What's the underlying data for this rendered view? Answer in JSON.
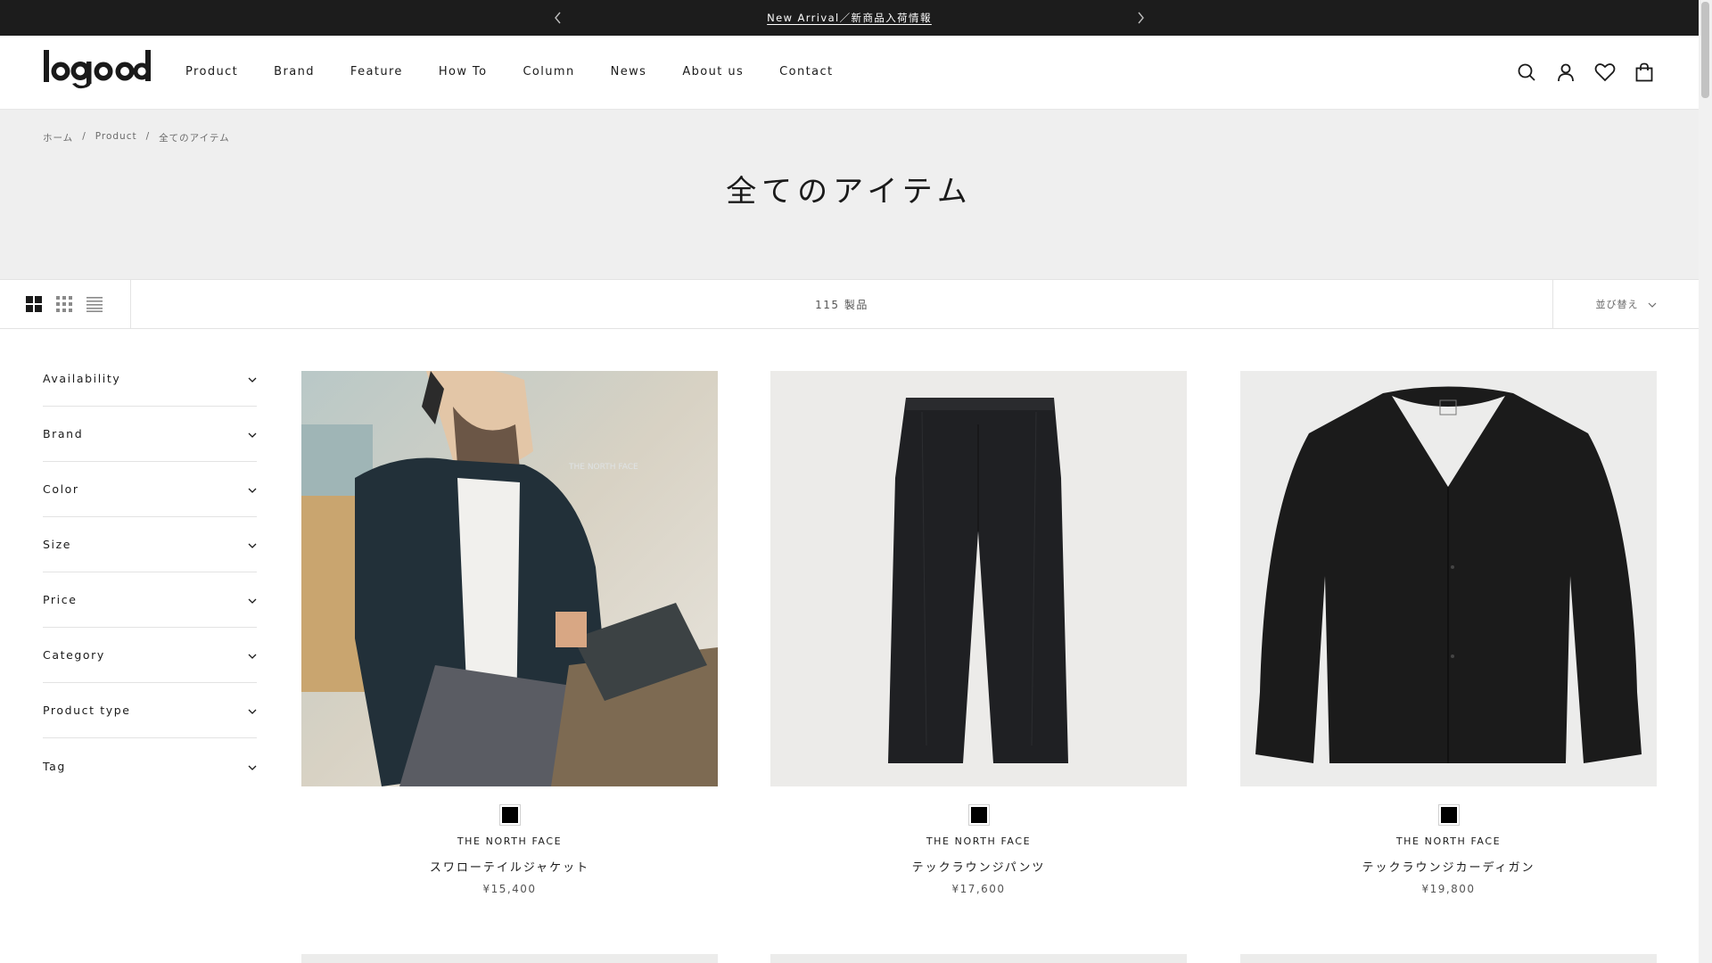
{
  "announcement": {
    "text": "New Arrival／新商品入荷情報"
  },
  "header": {
    "logo_text": "logood",
    "nav": [
      "Product",
      "Brand",
      "Feature",
      "How To",
      "Column",
      "News",
      "About us",
      "Contact"
    ],
    "icons": [
      "search-icon",
      "account-icon",
      "wishlist-icon",
      "cart-icon"
    ]
  },
  "breadcrumb": [
    "ホーム",
    "Product",
    "全てのアイテム"
  ],
  "page_title": "全てのアイテム",
  "toolbar": {
    "view_options": [
      "grid-large-icon",
      "grid-small-icon",
      "list-icon"
    ],
    "count": "115 製品",
    "sort_label": "並び替え"
  },
  "filters": [
    "Availability",
    "Brand",
    "Color",
    "Size",
    "Price",
    "Category",
    "Product type",
    "Tag"
  ],
  "products": [
    {
      "brand": "THE NORTH FACE",
      "name": "スワローテイルジャケット",
      "price": "¥15,400",
      "swatch_color": "#000000"
    },
    {
      "brand": "THE NORTH FACE",
      "name": "テックラウンジパンツ",
      "price": "¥17,600",
      "swatch_color": "#000000"
    },
    {
      "brand": "THE NORTH FACE",
      "name": "テックラウンジカーディガン",
      "price": "¥19,800",
      "swatch_color": "#000000"
    }
  ],
  "colors": {
    "announce_bg": "#1c1c1c",
    "banner_bg": "#efefef",
    "image_bg": "#ececeb"
  }
}
